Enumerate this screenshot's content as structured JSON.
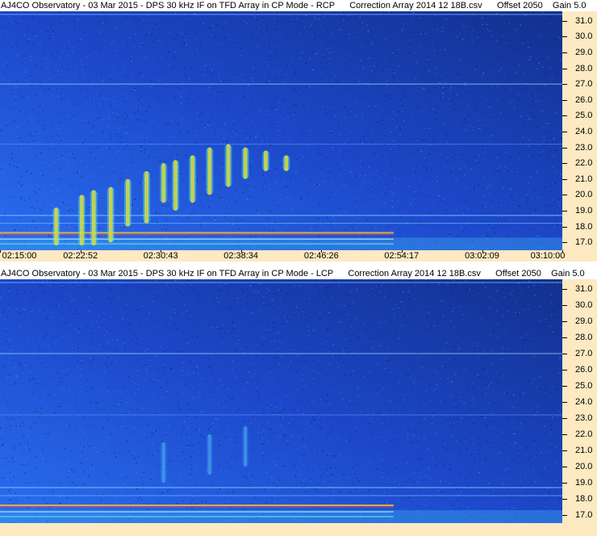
{
  "panels": [
    {
      "title": "AJ4CO Observatory - 03 Mar 2015 - DPS 30 kHz IF on TFD Array in CP Mode - RCP      Correction Array 2014 12 18B.csv      Offset 2050    Gain 5.0",
      "mode": "RCP"
    },
    {
      "title": "AJ4CO Observatory - 03 Mar 2015 - DPS 30 kHz IF on TFD Array in CP Mode - LCP      Correction Array 2014 12 18B.csv      Offset 2050    Gain 5.0",
      "mode": "LCP"
    }
  ],
  "chart_data": [
    {
      "type": "heatmap",
      "polarization": "RCP",
      "x_ticks": [
        "02:15:00",
        "02:22:52",
        "02:30:43",
        "02:38:34",
        "02:46:26",
        "02:54:17",
        "03:02:09",
        "03:10:00"
      ],
      "y_ticks": [
        "31.0",
        "30.0",
        "29.0",
        "28.0",
        "27.0",
        "26.0",
        "25.0",
        "24.0",
        "23.0",
        "22.0",
        "21.0",
        "20.0",
        "19.0",
        "18.0",
        "17.0"
      ],
      "xlim": [
        "02:15:00",
        "03:10:00"
      ],
      "ylim": [
        16.5,
        31.6
      ],
      "burst_features": [
        {
          "time": "02:20:30",
          "freq_low": 16.8,
          "freq_high": 19.2
        },
        {
          "time": "02:23:00",
          "freq_low": 16.8,
          "freq_high": 20.0
        },
        {
          "time": "02:24:10",
          "freq_low": 16.8,
          "freq_high": 20.3
        },
        {
          "time": "02:25:50",
          "freq_low": 17.0,
          "freq_high": 20.5
        },
        {
          "time": "02:27:30",
          "freq_low": 18.0,
          "freq_high": 21.0
        },
        {
          "time": "02:29:20",
          "freq_low": 18.2,
          "freq_high": 21.5
        },
        {
          "time": "02:31:00",
          "freq_low": 19.5,
          "freq_high": 22.0
        },
        {
          "time": "02:32:10",
          "freq_low": 19.0,
          "freq_high": 22.2
        },
        {
          "time": "02:33:50",
          "freq_low": 19.5,
          "freq_high": 22.5
        },
        {
          "time": "02:35:30",
          "freq_low": 20.0,
          "freq_high": 23.0
        },
        {
          "time": "02:37:20",
          "freq_low": 20.5,
          "freq_high": 23.2
        },
        {
          "time": "02:39:00",
          "freq_low": 21.0,
          "freq_high": 23.0
        },
        {
          "time": "02:41:00",
          "freq_low": 21.5,
          "freq_high": 22.8
        },
        {
          "time": "02:43:00",
          "freq_low": 21.5,
          "freq_high": 22.5
        }
      ],
      "colormap": [
        "#0a1a7a",
        "#1f4fd6",
        "#2fa0ff",
        "#5fe0d0",
        "#c8f050",
        "#f0c030",
        "#ff4040",
        "#ffffff"
      ]
    },
    {
      "type": "heatmap",
      "polarization": "LCP",
      "x_ticks": [],
      "y_ticks": [
        "31.0",
        "30.0",
        "29.0",
        "28.0",
        "27.0",
        "26.0",
        "25.0",
        "24.0",
        "23.0",
        "22.0",
        "21.0",
        "20.0",
        "19.0",
        "18.0",
        "17.0"
      ],
      "xlim": [
        "02:15:00",
        "03:10:00"
      ],
      "ylim": [
        16.5,
        31.6
      ],
      "burst_features": [
        {
          "time": "02:31:00",
          "freq_low": 19.0,
          "freq_high": 21.5
        },
        {
          "time": "02:35:30",
          "freq_low": 19.5,
          "freq_high": 22.0
        },
        {
          "time": "02:39:00",
          "freq_low": 20.0,
          "freq_high": 22.5
        }
      ],
      "colormap": [
        "#0a1a7a",
        "#1f4fd6",
        "#2fa0ff",
        "#5fe0d0",
        "#c8f050",
        "#f0c030",
        "#ff4040",
        "#ffffff"
      ]
    }
  ]
}
